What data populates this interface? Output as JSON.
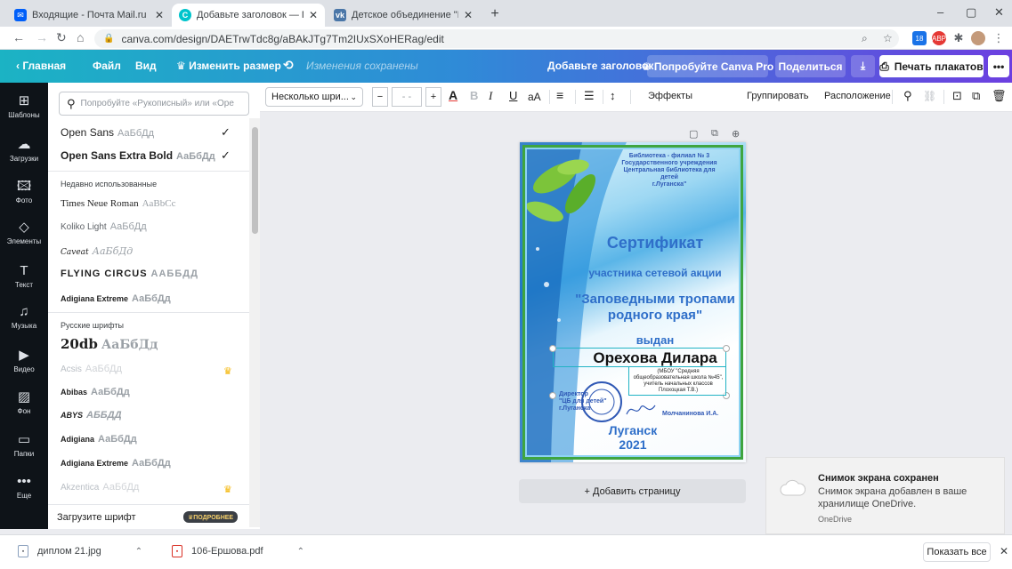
{
  "browser": {
    "tabs": [
      {
        "title": "Входящие - Почта Mail.ru",
        "icon": "mail-icon",
        "color": "#005ff9"
      },
      {
        "title": "Добавьте заголовок — Плакат",
        "icon": "canva-icon",
        "color": "#00c4cc"
      },
      {
        "title": "Детское объединение \"Бересте",
        "icon": "vk-icon",
        "color": "#4a76a8"
      }
    ],
    "new_tab": "+",
    "url": "canva.com/design/DAETrwTdc8g/aBAkJTg7Tm2IUxSXoHERag/edit",
    "window_controls": [
      "–",
      "▢",
      "✕"
    ]
  },
  "canva_bar": {
    "back": "‹ Главная",
    "file": "Файл",
    "view": "Вид",
    "resize": "♛ Изменить размер",
    "undo": "⟲",
    "saved": "Изменения сохранены",
    "title": "Добавьте заголовок",
    "try_pro": "♛ Попробуйте Canva Pro",
    "share": "Поделиться",
    "download": "⤓",
    "print": "Печать плакатов",
    "more": "•••"
  },
  "rail": [
    {
      "icon": "layout-icon",
      "glyph": "⊞",
      "label": "Шаблоны"
    },
    {
      "icon": "upload-icon",
      "glyph": "☁",
      "label": "Загрузки"
    },
    {
      "icon": "photo-icon",
      "glyph": "🖾",
      "label": "Фото"
    },
    {
      "icon": "elements-icon",
      "glyph": "◇",
      "label": "Элементы"
    },
    {
      "icon": "text-icon",
      "glyph": "T",
      "label": "Текст"
    },
    {
      "icon": "music-icon",
      "glyph": "♫",
      "label": "Музыка"
    },
    {
      "icon": "video-icon",
      "glyph": "▶",
      "label": "Видео"
    },
    {
      "icon": "background-icon",
      "glyph": "▨",
      "label": "Фон"
    },
    {
      "icon": "folder-icon",
      "glyph": "▭",
      "label": "Папки"
    },
    {
      "icon": "more-icon",
      "glyph": "•••",
      "label": "Еще"
    }
  ],
  "font_panel": {
    "search_placeholder": "Попробуйте «Рукописный» или «Оре",
    "selected": [
      {
        "name": "Open Sans",
        "sample": "АаБбДд"
      },
      {
        "name": "Open Sans Extra Bold",
        "sample": "АаБбДд"
      }
    ],
    "recent_heading": "Недавно использованные",
    "recent": [
      {
        "name": "Times Neue Roman",
        "sample": "AaBbCc"
      },
      {
        "name": "Koliko Light",
        "sample": "АаБбДд"
      },
      {
        "name": "Caveat",
        "sample": "АаБбДд"
      },
      {
        "name": "FLYING CIRCUS",
        "sample": "ААББДД"
      },
      {
        "name": "Adigiana Extreme",
        "sample": "АаБбДд"
      }
    ],
    "russian_heading": "Русские шрифты",
    "russian": [
      {
        "name": "20db",
        "sample": "АаБбДд",
        "pro": false
      },
      {
        "name": "Acsis",
        "sample": "АаБбДд",
        "pro": true
      },
      {
        "name": "Abibas",
        "sample": "АаБбДд",
        "pro": false
      },
      {
        "name": "ABYS",
        "sample": "АББДД",
        "pro": false
      },
      {
        "name": "Adigiana",
        "sample": "АаБбДд",
        "pro": false
      },
      {
        "name": "Adigiana Extreme",
        "sample": "АаБбДд",
        "pro": false
      },
      {
        "name": "Akzentica",
        "sample": "АаБбДд",
        "pro": true
      }
    ],
    "upload_label": "Загрузите шрифт",
    "upload_badge": "♛ПОДРОБНЕЕ"
  },
  "editor_toolbar": {
    "font": "Несколько шри...",
    "minus": "−",
    "size": "- -",
    "plus": "+",
    "color_a": "A",
    "bold": "B",
    "italic": "I",
    "underline": "U",
    "case": "aA",
    "align": "≡",
    "list": "☰",
    "spacing": "↕",
    "effects": "Эффекты",
    "group": "Группировать",
    "arrange": "Расположение"
  },
  "certificate": {
    "header_lines": [
      "Библиотека - филиал № 3",
      "Государственного учреждения",
      "Центральная библиотека для детей",
      "г.Луганска\""
    ],
    "title": "Сертификат",
    "subtitle": "участника сетевой акции",
    "campaign_line1": "\"Заповедными тропами",
    "campaign_line2": "родного края\"",
    "issued": "выдан",
    "name": "Орехова Дилара",
    "school_lines": [
      "(МБОУ \"Средняя",
      "общеобразовательная школа №45\",",
      "учитель начальных классов",
      "Плохоцкая Т.В.)"
    ],
    "director_lines": [
      "Директор",
      "\"ЦБ для детей\"",
      "г.Луганска"
    ],
    "director_name": "Молчанинова И.А.",
    "city": "Луганск",
    "year": "2021"
  },
  "add_page": "+ Добавить страницу",
  "toast": {
    "title": "Снимок экрана сохранен",
    "body": "Снимок экрана добавлен в ваше хранилище OneDrive.",
    "source": "OneDrive"
  },
  "downloads": [
    {
      "name": "диплом 21.jpg",
      "type": "image"
    },
    {
      "name": "106-Ершова.pdf",
      "type": "pdf"
    }
  ],
  "show_all": "Показать все"
}
